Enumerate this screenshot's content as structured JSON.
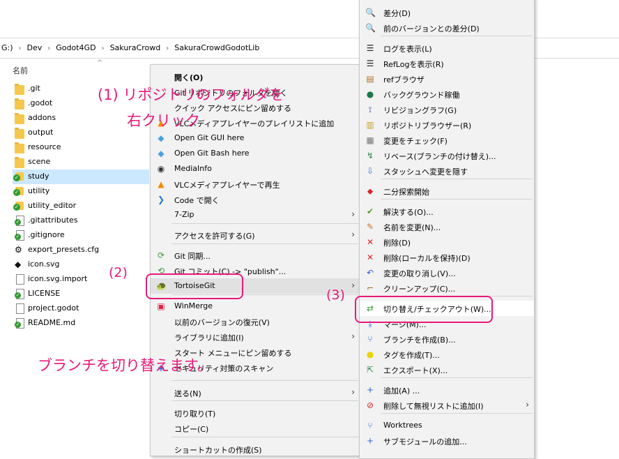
{
  "explorer": {
    "breadcrumb": [
      "G:)",
      "Dev",
      "Godot4GD",
      "SakuraCrowd",
      "SakuraCrowdGodotLib"
    ],
    "column_name": "名前",
    "files": [
      {
        "name": ".git",
        "icon": "folder-icon"
      },
      {
        "name": ".godot",
        "icon": "folder-icon"
      },
      {
        "name": "addons",
        "icon": "folder-icon"
      },
      {
        "name": "output",
        "icon": "folder-icon"
      },
      {
        "name": "resource",
        "icon": "folder-icon"
      },
      {
        "name": "scene",
        "icon": "folder-icon"
      },
      {
        "name": "study",
        "icon": "git-folder-ok-icon",
        "selected": true
      },
      {
        "name": "utility",
        "icon": "git-folder-ok-icon"
      },
      {
        "name": "utility_editor",
        "icon": "git-folder-ok-icon"
      },
      {
        "name": ".gitattributes",
        "icon": "git-file-ok-icon"
      },
      {
        "name": ".gitignore",
        "icon": "git-file-ok-icon"
      },
      {
        "name": "export_presets.cfg",
        "icon": "gear-file-icon"
      },
      {
        "name": "icon.svg",
        "icon": "inkscape-icon"
      },
      {
        "name": "icon.svg.import",
        "icon": "file-icon"
      },
      {
        "name": "LICENSE",
        "icon": "git-file-ok-icon"
      },
      {
        "name": "project.godot",
        "icon": "file-icon"
      },
      {
        "name": "README.md",
        "icon": "git-file-ok-icon"
      }
    ]
  },
  "context_menu": {
    "items": [
      {
        "label": "開く(O)",
        "bold": true
      },
      {
        "label": "Git リポジトリのフォルダを開く"
      },
      {
        "label": "クイック アクセスにピン留めする"
      },
      {
        "label": "VLCメディアプレイヤーのプレイリストに追加",
        "icon": "vlc-icon"
      },
      {
        "label": "Open Git GUI here",
        "icon": "git-gui-icon"
      },
      {
        "label": "Open Git Bash here",
        "icon": "git-bash-icon"
      },
      {
        "label": "MediaInfo",
        "icon": "mediainfo-icon"
      },
      {
        "label": "VLCメディアプレイヤーで再生",
        "icon": "vlc-icon"
      },
      {
        "label": "Code で開く",
        "icon": "vscode-icon"
      },
      {
        "label": "7-Zip",
        "arrow": true
      },
      {
        "label": "アクセスを許可する(G)",
        "arrow": true
      },
      {
        "label": "Git 同期...",
        "icon": "git-sync-icon"
      },
      {
        "label": "Git コミット(C) -> \"publish\"...",
        "icon": "git-commit-icon"
      },
      {
        "label": "TortoiseGit",
        "icon": "tortoisegit-icon",
        "arrow": true
      },
      {
        "label": "WinMerge",
        "icon": "winmerge-icon"
      },
      {
        "label": "以前のバージョンの復元(V)"
      },
      {
        "label": "ライブラリに追加(I)",
        "arrow": true
      },
      {
        "label": "スタート メニューにピン留めする"
      },
      {
        "label": "セキュリティ対策のスキャン",
        "icon": "defender-icon"
      },
      {
        "label": "送る(N)",
        "arrow": true
      },
      {
        "label": "切り取り(T)"
      },
      {
        "label": "コピー(C)"
      },
      {
        "label": "ショートカットの作成(S)"
      }
    ]
  },
  "tortoise_menu": {
    "items": [
      {
        "label": "差分(D)",
        "icon": "diff-icon"
      },
      {
        "label": "前のバージョンとの差分(D)",
        "icon": "diff-icon"
      },
      {
        "label": "ログを表示(L)",
        "icon": "log-icon"
      },
      {
        "label": "RefLogを表示(R)",
        "icon": "log-icon"
      },
      {
        "label": "refブラウザ",
        "icon": "ref-browser-icon"
      },
      {
        "label": "バックグラウンド稼働",
        "icon": "globe-icon"
      },
      {
        "label": "リビジョングラフ(G)",
        "icon": "revision-graph-icon"
      },
      {
        "label": "リポジトリブラウザー(R)",
        "icon": "repo-browser-icon"
      },
      {
        "label": "変更をチェック(F)",
        "icon": "check-changes-icon"
      },
      {
        "label": "リベース(ブランチの付け替え)...",
        "icon": "rebase-icon"
      },
      {
        "label": "スタッシュへ変更を隠す",
        "icon": "stash-icon"
      },
      {
        "label": "二分探索開始",
        "icon": "bisect-icon"
      },
      {
        "label": "解決する(O)...",
        "icon": "resolve-icon"
      },
      {
        "label": "名前を変更(N)...",
        "icon": "rename-icon"
      },
      {
        "label": "削除(D)",
        "icon": "delete-icon"
      },
      {
        "label": "削除(ローカルを保持)(D)",
        "icon": "delete-icon"
      },
      {
        "label": "変更の取り消し(V)...",
        "icon": "revert-icon"
      },
      {
        "label": "クリーンアップ(C)...",
        "icon": "cleanup-icon"
      },
      {
        "label": "切り替え/チェックアウト(W)...",
        "icon": "switch-icon"
      },
      {
        "label": "マージ(M)...",
        "icon": "merge-icon"
      },
      {
        "label": "ブランチを作成(B)...",
        "icon": "branch-icon"
      },
      {
        "label": "タグを作成(T)...",
        "icon": "tag-icon"
      },
      {
        "label": "エクスポート(X)...",
        "icon": "export-icon"
      },
      {
        "label": "追加(A) ...",
        "icon": "add-icon"
      },
      {
        "label": "削除して無視リストに追加(I)",
        "icon": "ignore-icon",
        "arrow": true
      },
      {
        "label": "Worktrees",
        "icon": "worktree-icon"
      },
      {
        "label": "サブモジュールの追加...",
        "icon": "add-icon"
      }
    ]
  },
  "annotations": {
    "step1_line1": "(1) リポジトリのフォルダを",
    "step1_line2": "右クリック",
    "step2": "(2)",
    "step3": "(3)",
    "bottom_note": "ブランチを切り替えます。",
    "color": "#e8197a"
  }
}
